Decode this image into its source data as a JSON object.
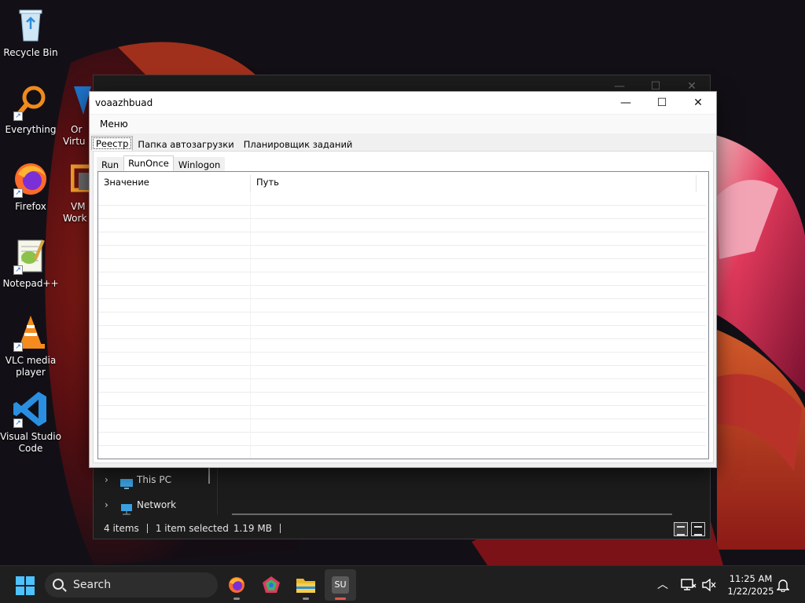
{
  "desktop": {
    "icons": [
      {
        "label": "Recycle Bin",
        "icon": "recycle-bin-icon"
      },
      {
        "label": "Everything",
        "icon": "everything-search-icon"
      },
      {
        "label": "Firefox",
        "icon": "firefox-icon"
      },
      {
        "label": "Notepad++",
        "icon": "notepad-plus-plus-icon"
      },
      {
        "label": "VLC media player",
        "icon": "vlc-cone-icon"
      },
      {
        "label": "Visual Studio Code",
        "icon": "vscode-icon"
      },
      {
        "label": "Or Virtu",
        "icon": "virtualbox-icon"
      },
      {
        "label": "VM Work",
        "icon": "vmware-icon"
      }
    ]
  },
  "explorer": {
    "nav": [
      {
        "label": "This PC",
        "icon": "this-pc-icon"
      },
      {
        "label": "Network",
        "icon": "network-icon"
      }
    ],
    "status": {
      "items": "4 items",
      "selected": "1 item selected",
      "size": "1.19 MB"
    }
  },
  "app": {
    "title": "voaazhbuad",
    "menu": "Меню",
    "outer_tabs": [
      "Реестр",
      "Папка автозагрузки",
      "Планировщик заданий"
    ],
    "outer_active": 0,
    "inner_tabs": [
      "Run",
      "RunOnce",
      "Winlogon"
    ],
    "inner_active": 1,
    "columns": [
      "Значение",
      "Путь"
    ],
    "rows": []
  },
  "taskbar": {
    "search_placeholder": "Search",
    "apps": [
      "firefox-icon",
      "pentagon-app-icon",
      "file-explorer-icon",
      "su-app-icon"
    ],
    "su_label": "SU",
    "time": "11:25 AM",
    "date": "1/22/2025"
  },
  "colors": {
    "accent": "#4cc2ff",
    "taskbar_bg": "#1f1f1f",
    "active_indicator": "#e2574c"
  }
}
